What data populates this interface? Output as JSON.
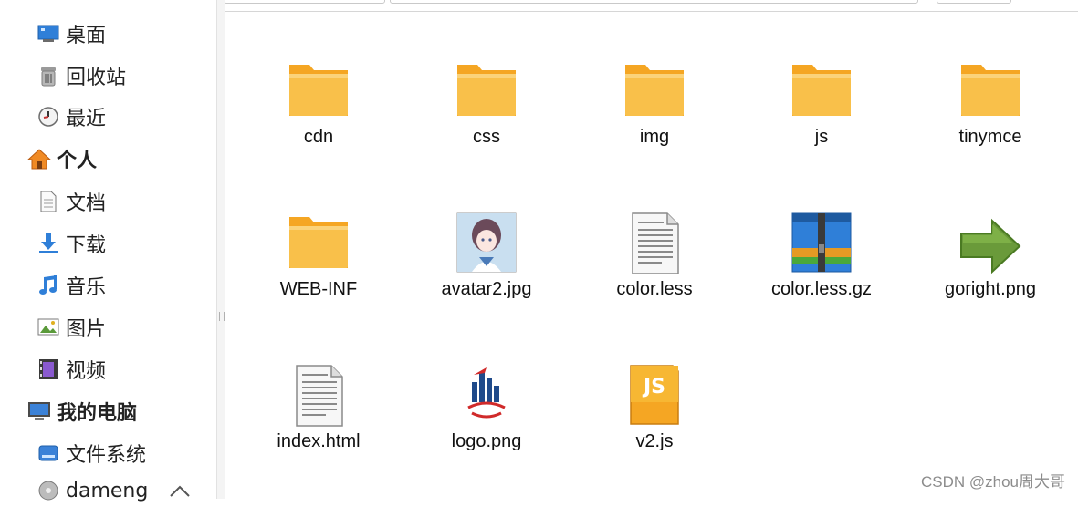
{
  "sidebar": {
    "items": [
      {
        "label": "桌面",
        "icon": "desktop-icon"
      },
      {
        "label": "回收站",
        "icon": "trash-icon"
      },
      {
        "label": "最近",
        "icon": "clock-icon"
      },
      {
        "label": "个人",
        "icon": "home-icon",
        "section": true
      },
      {
        "label": "文档",
        "icon": "document-icon"
      },
      {
        "label": "下载",
        "icon": "download-icon"
      },
      {
        "label": "音乐",
        "icon": "music-icon"
      },
      {
        "label": "图片",
        "icon": "picture-icon"
      },
      {
        "label": "视频",
        "icon": "video-icon"
      },
      {
        "label": "我的电脑",
        "icon": "computer-icon",
        "section": true
      },
      {
        "label": "文件系统",
        "icon": "drive-icon"
      },
      {
        "label": "dameng",
        "icon": "disk-icon"
      }
    ]
  },
  "files": [
    {
      "name": "cdn",
      "icon": "folder-icon"
    },
    {
      "name": "css",
      "icon": "folder-icon"
    },
    {
      "name": "img",
      "icon": "folder-icon"
    },
    {
      "name": "js",
      "icon": "folder-icon"
    },
    {
      "name": "tinymce",
      "icon": "folder-icon"
    },
    {
      "name": "WEB-INF",
      "icon": "folder-icon"
    },
    {
      "name": "avatar2.jpg",
      "icon": "image-thumbnail-icon"
    },
    {
      "name": "color.less",
      "icon": "text-file-icon"
    },
    {
      "name": "color.less.gz",
      "icon": "archive-icon"
    },
    {
      "name": "goright.png",
      "icon": "green-arrow-icon"
    },
    {
      "name": "index.html",
      "icon": "text-file-icon"
    },
    {
      "name": "logo.png",
      "icon": "logo-image-icon"
    },
    {
      "name": "v2.js",
      "icon": "javascript-file-icon"
    }
  ],
  "watermark": "CSDN @zhou周大哥",
  "colors": {
    "folder": "#f7b733",
    "folder_tab": "#f5a623",
    "accent": "#3a7bd5"
  }
}
